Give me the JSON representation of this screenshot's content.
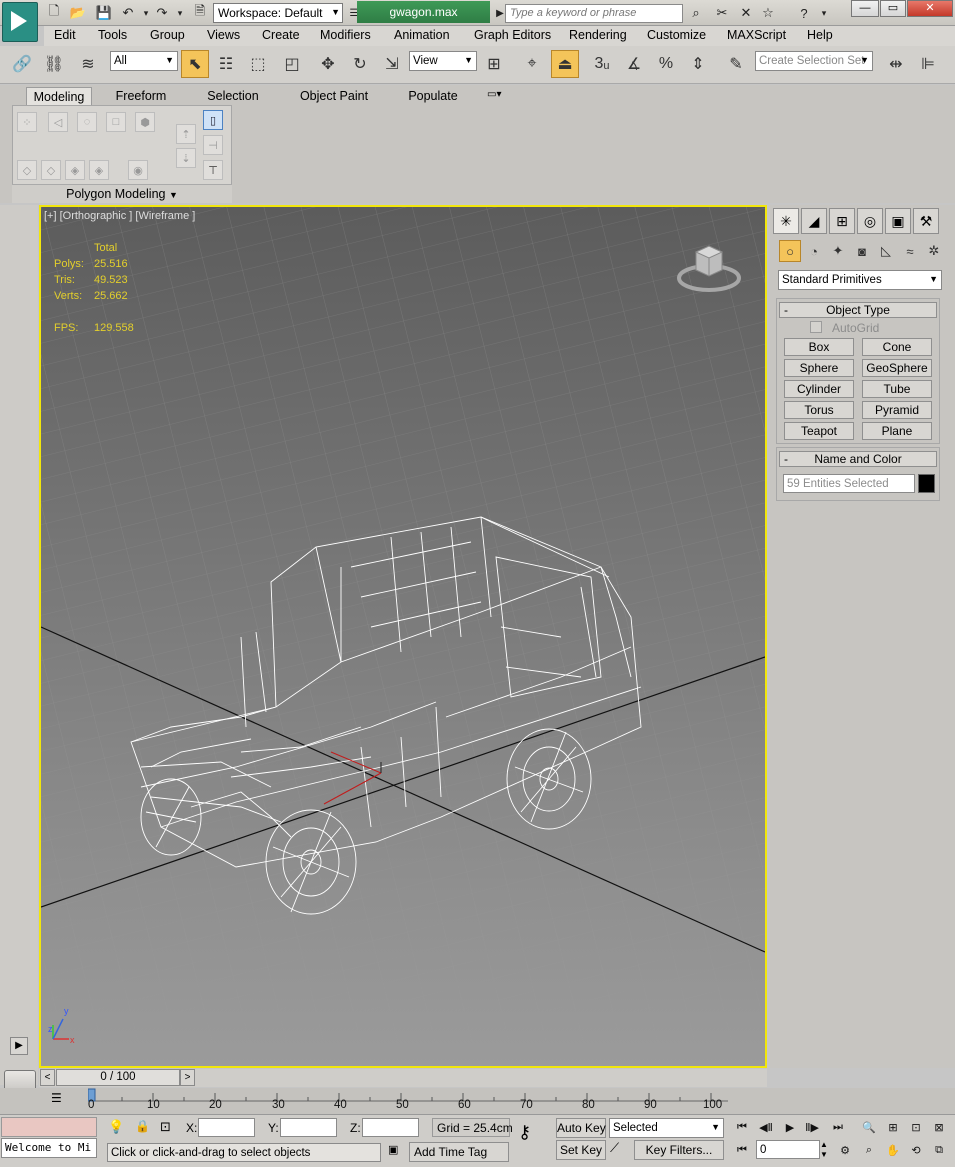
{
  "titlebar": {
    "workspace": "Workspace: Default",
    "filename": "gwagon.max",
    "search_placeholder": "Type a keyword or phrase",
    "win_minimize": "—",
    "win_maximize": "▭",
    "win_close": "✕"
  },
  "menu": [
    "Edit",
    "Tools",
    "Group",
    "Views",
    "Create",
    "Modifiers",
    "Animation",
    "Graph Editors",
    "Rendering",
    "Customize",
    "MAXScript",
    "Help"
  ],
  "toolbar": {
    "filter_value": "All",
    "refcoord_value": "View",
    "selection_set_placeholder": "Create Selection Set",
    "snap_label": "3"
  },
  "ribbon": {
    "tabs": [
      "Modeling",
      "Freeform",
      "Selection",
      "Object Paint",
      "Populate"
    ],
    "active_tab": "Modeling",
    "panel_label": "Polygon Modeling"
  },
  "viewport": {
    "label": "[+] [Orthographic ] [Wireframe ]",
    "stats": {
      "total_label": "Total",
      "polys_label": "Polys:",
      "polys_value": "25.516",
      "tris_label": "Tris:",
      "tris_value": "49.523",
      "verts_label": "Verts:",
      "verts_value": "25.662",
      "fps_label": "FPS:",
      "fps_value": "129.558"
    },
    "axis_x": "x",
    "axis_y": "y",
    "axis_z": "z"
  },
  "command_panel": {
    "category_dropdown": "Standard Primitives",
    "object_type_title": "Object Type",
    "autogrid_label": "AutoGrid",
    "primitives": [
      "Box",
      "Cone",
      "Sphere",
      "GeoSphere",
      "Cylinder",
      "Tube",
      "Torus",
      "Pyramid",
      "Teapot",
      "Plane"
    ],
    "name_color_title": "Name and Color",
    "name_field": "59 Entities Selected",
    "object_color": "#000000"
  },
  "timeline": {
    "slider_text": "0 / 100",
    "ticks": [
      "0",
      "10",
      "20",
      "30",
      "40",
      "50",
      "60",
      "70",
      "80",
      "90",
      "100"
    ]
  },
  "status": {
    "welcome_text": "Welcome to Mi",
    "prompt": "Click or click-and-drag to select objects",
    "x_label": "X:",
    "y_label": "Y:",
    "z_label": "Z:",
    "x_value": "",
    "y_value": "",
    "z_value": "",
    "grid": "Grid = 25.4cm",
    "add_time_tag": "Add Time Tag",
    "auto_key": "Auto Key",
    "set_key": "Set Key",
    "key_mode": "Selected",
    "key_filters": "Key Filters...",
    "frame_value": "0"
  },
  "colors": {
    "viewport_border": "#f1e60b",
    "stats_text": "#e3cf2c",
    "active_button": "#f4c45a",
    "file_tab": "#35894d"
  }
}
